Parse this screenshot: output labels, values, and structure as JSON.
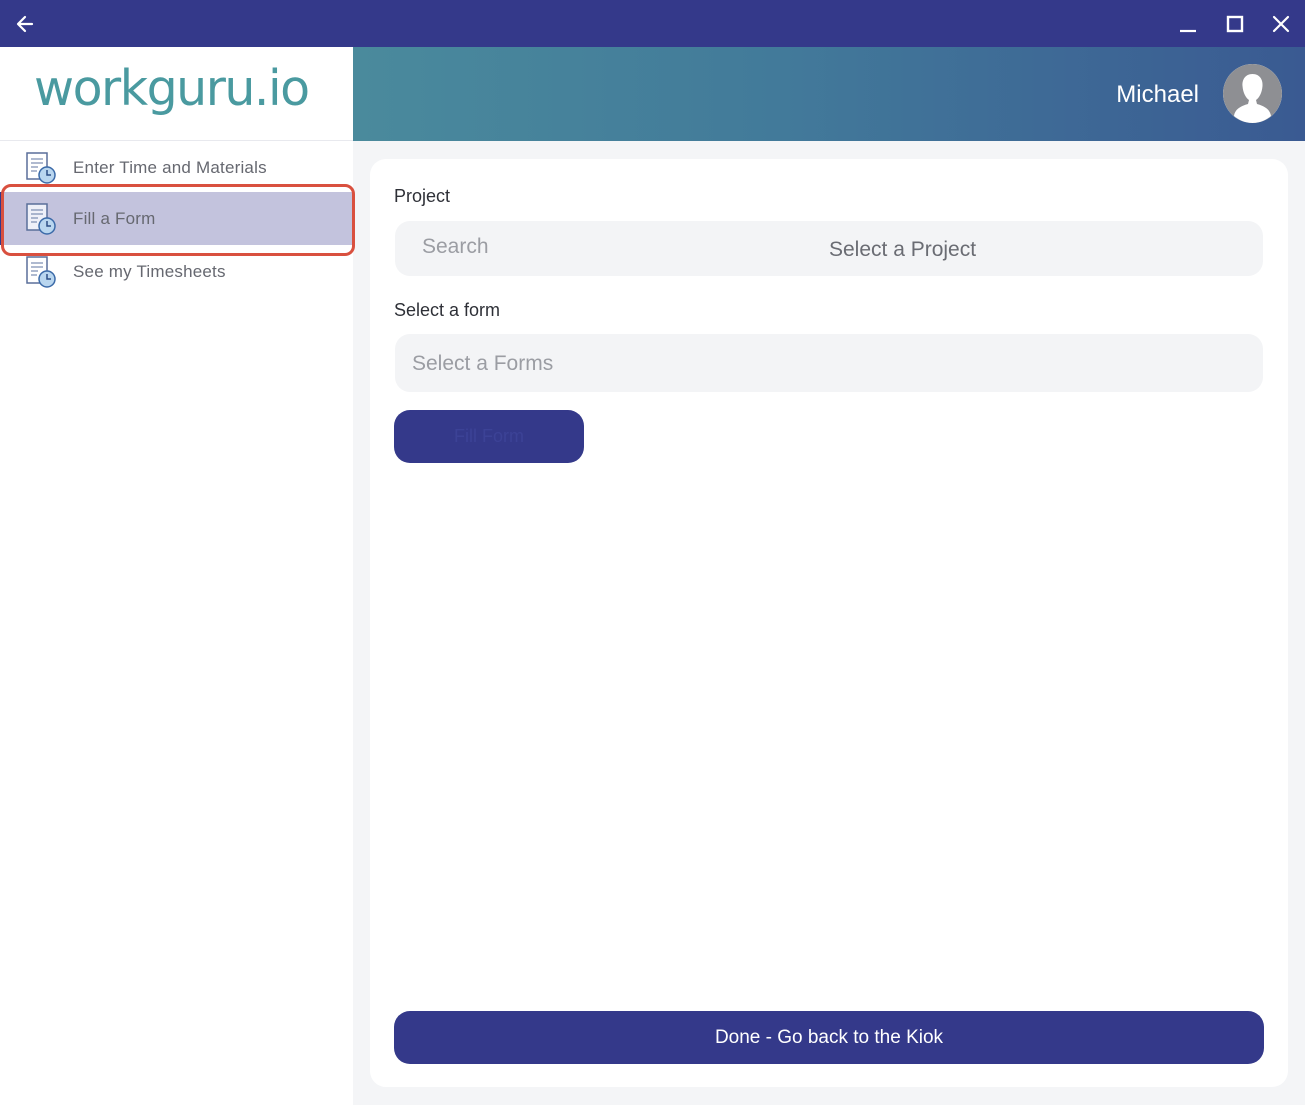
{
  "titlebar": {
    "back_icon": "arrow-left-icon",
    "minimize_icon": "minimize-icon",
    "maximize_icon": "maximize-icon",
    "close_icon": "close-icon",
    "background_color": "#34398a"
  },
  "sidebar": {
    "logo_text": "workguru.io",
    "logo_color": "#4a9aa0",
    "items": [
      {
        "label": "Enter Time and Materials",
        "icon": "timesheet-clock-icon",
        "active": false
      },
      {
        "label": "Fill a Form",
        "icon": "timesheet-clock-icon",
        "active": true
      },
      {
        "label": "See my Timesheets",
        "icon": "timesheet-clock-icon",
        "active": false
      }
    ],
    "active_background": "#c3c3dd",
    "highlight_color": "#d9503f"
  },
  "header": {
    "user_name": "Michael",
    "avatar_icon": "user-avatar-icon"
  },
  "main": {
    "project_label": "Project",
    "project_search_placeholder": "Search",
    "project_select_text": "Select a Project",
    "form_label": "Select a form",
    "form_select_placeholder": "Select a Forms",
    "fill_button_label": "Fill Form",
    "done_button_label": "Done - Go back to the Kiok",
    "primary_color": "#34398a"
  }
}
